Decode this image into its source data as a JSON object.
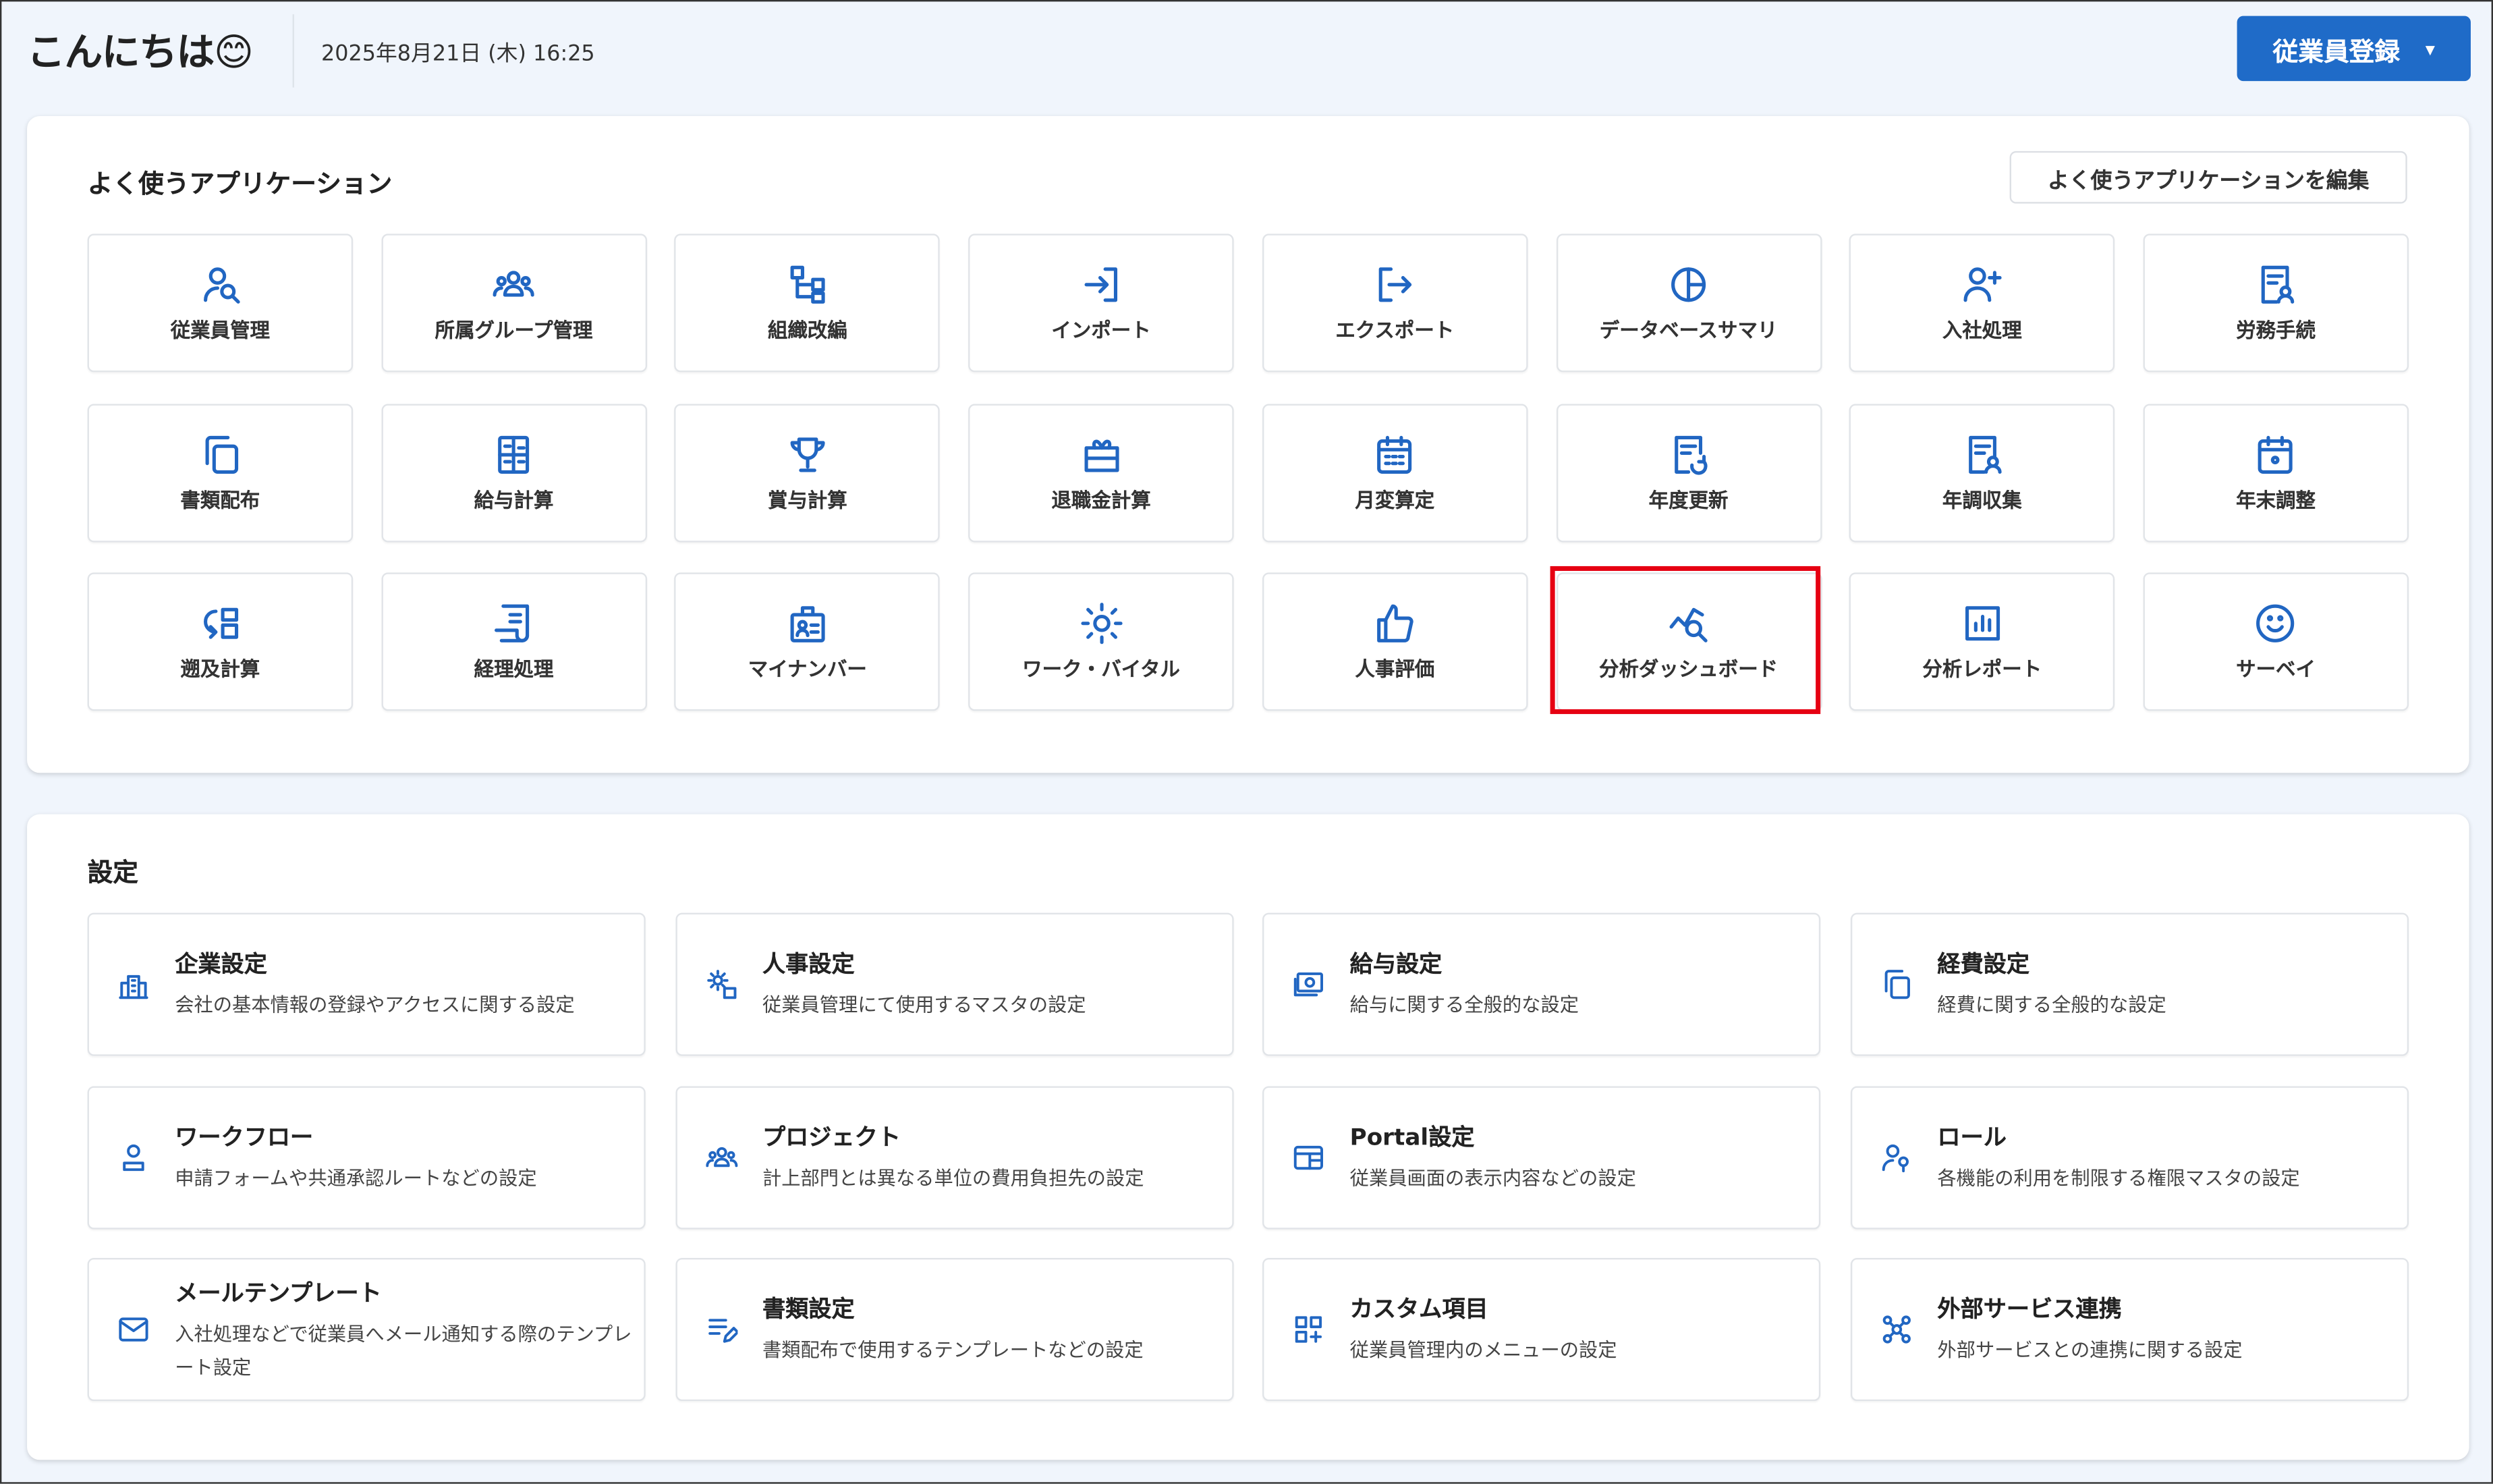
{
  "header": {
    "greeting": "こんにちは😊",
    "date": "2025年8月21日 (木) 16:25",
    "register_button": "従業員登録",
    "register_caret": "▾"
  },
  "apps": {
    "title": "よく使うアプリケーション",
    "edit_button": "よく使うアプリケーションを編集",
    "items": [
      {
        "label": "従業員管理",
        "icon": "user-search"
      },
      {
        "label": "所属グループ管理",
        "icon": "group"
      },
      {
        "label": "組織改編",
        "icon": "org"
      },
      {
        "label": "インポート",
        "icon": "import"
      },
      {
        "label": "エクスポート",
        "icon": "export"
      },
      {
        "label": "データベースサマリ",
        "icon": "pie"
      },
      {
        "label": "入社処理",
        "icon": "user-add"
      },
      {
        "label": "労務手続",
        "icon": "doc-user"
      },
      {
        "label": "書類配布",
        "icon": "copy"
      },
      {
        "label": "給与計算",
        "icon": "calculator"
      },
      {
        "label": "賞与計算",
        "icon": "trophy"
      },
      {
        "label": "退職金計算",
        "icon": "gift"
      },
      {
        "label": "月変算定",
        "icon": "calendar-grid"
      },
      {
        "label": "年度更新",
        "icon": "doc-refresh"
      },
      {
        "label": "年調収集",
        "icon": "doc-user"
      },
      {
        "label": "年末調整",
        "icon": "calendar"
      },
      {
        "label": "遡及計算",
        "icon": "retro"
      },
      {
        "label": "経理処理",
        "icon": "receipt"
      },
      {
        "label": "マイナンバー",
        "icon": "id-card"
      },
      {
        "label": "ワーク・バイタル",
        "icon": "sun"
      },
      {
        "label": "人事評価",
        "icon": "thumb"
      },
      {
        "label": "分析ダッシュボード",
        "icon": "chart-search",
        "highlighted": true
      },
      {
        "label": "分析レポート",
        "icon": "bar-chart"
      },
      {
        "label": "サーベイ",
        "icon": "smile"
      }
    ]
  },
  "settings": {
    "title": "設定",
    "items": [
      {
        "title": "企業設定",
        "desc": "会社の基本情報の登録やアクセスに関する設定",
        "icon": "building"
      },
      {
        "title": "人事設定",
        "desc": "従業員管理にて使用するマスタの設定",
        "icon": "gear-user"
      },
      {
        "title": "給与設定",
        "desc": "給与に関する全般的な設定",
        "icon": "money"
      },
      {
        "title": "経費設定",
        "desc": "経費に関する全般的な設定",
        "icon": "copy"
      },
      {
        "title": "ワークフロー",
        "desc": "申請フォームや共通承認ルートなどの設定",
        "icon": "user"
      },
      {
        "title": "プロジェクト",
        "desc": "計上部門とは異なる単位の費用負担先の設定",
        "icon": "group"
      },
      {
        "title": "Portal設定",
        "desc": "従業員画面の表示内容などの設定",
        "icon": "portal"
      },
      {
        "title": "ロール",
        "desc": "各機能の利用を制限する権限マスタの設定",
        "icon": "user-key"
      },
      {
        "title": "メールテンプレート",
        "desc": "入社処理などで従業員へメール通知する際のテンプレート設定",
        "icon": "mail"
      },
      {
        "title": "書類設定",
        "desc": "書類配布で使用するテンプレートなどの設定",
        "icon": "list-edit"
      },
      {
        "title": "カスタム項目",
        "desc": "従業員管理内のメニューの設定",
        "icon": "grid-plus"
      },
      {
        "title": "外部サービス連携",
        "desc": "外部サービスとの連携に関する設定",
        "icon": "network"
      }
    ]
  },
  "colors": {
    "accent": "#1f6bc8",
    "highlight": "#e60012",
    "background": "#f0f5fc"
  }
}
